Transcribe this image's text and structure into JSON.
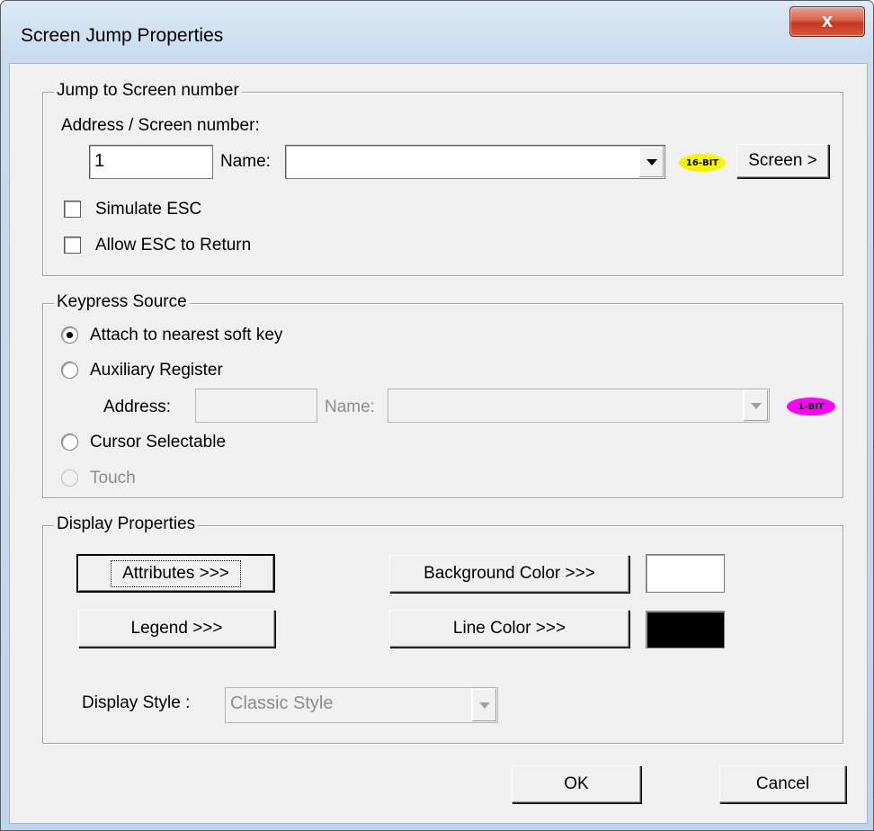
{
  "window": {
    "title": "Screen Jump Properties",
    "close_label": "x"
  },
  "jump_group": {
    "legend": "Jump to Screen number",
    "address_label": "Address / Screen number:",
    "address_value": "1",
    "name_label": "Name:",
    "name_value": "",
    "bit_badge": "16-BIT",
    "screen_button": "Screen >",
    "simulate_esc_label": "Simulate ESC",
    "simulate_esc_checked": false,
    "allow_esc_label": "Allow ESC to Return",
    "allow_esc_checked": false
  },
  "keypress_group": {
    "legend": "Keypress Source",
    "options": [
      {
        "label": "Attach to nearest soft key",
        "checked": true,
        "disabled": false
      },
      {
        "label": "Auxiliary Register",
        "checked": false,
        "disabled": false
      },
      {
        "label": "Cursor Selectable",
        "checked": false,
        "disabled": false
      },
      {
        "label": "Touch",
        "checked": false,
        "disabled": true
      }
    ],
    "address_label": "Address:",
    "address_value": "",
    "name_label": "Name:",
    "name_value": "",
    "bit_badge": "1-BIT"
  },
  "display_group": {
    "legend": "Display Properties",
    "attributes_button": "Attributes >>>",
    "legend_button": "Legend >>>",
    "background_color_button": "Background Color >>>",
    "line_color_button": "Line Color >>>",
    "background_color": "#ffffff",
    "line_color": "#000000",
    "display_style_label": "Display Style :",
    "display_style_value": "Classic Style"
  },
  "footer": {
    "ok_button": "OK",
    "cancel_button": "Cancel"
  },
  "colors": {
    "badge_16bit": "#f5f500",
    "badge_1bit": "#ff00ff"
  }
}
